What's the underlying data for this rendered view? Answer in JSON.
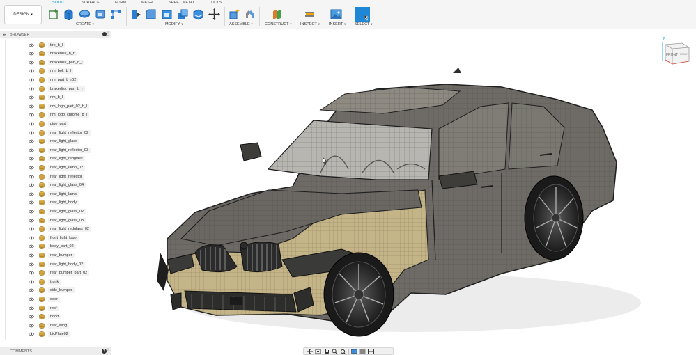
{
  "workspace": {
    "label": "DESIGN"
  },
  "tabs": [
    {
      "label": "SOLID",
      "active": true
    },
    {
      "label": "SURFACE",
      "active": false
    },
    {
      "label": "FORM",
      "active": false
    },
    {
      "label": "MESH",
      "active": false
    },
    {
      "label": "SHEET METAL",
      "active": false
    },
    {
      "label": "TOOLS",
      "active": false
    }
  ],
  "groups": {
    "create": "CREATE",
    "modify": "MODIFY",
    "assemble": "ASSEMBLE",
    "construct": "CONSTRUCT",
    "inspect": "INSPECT",
    "insert": "INSERT",
    "select": "SELECT"
  },
  "browser": {
    "title": "BROWSER",
    "items": [
      "tire_b_l",
      "brakedisk_b_r",
      "brakedisk_part_b_l",
      "rim_bolt_b_l",
      "rim_part_b_r02",
      "brakedisk_part_b_r",
      "rim_b_l",
      "rim_logo_part_02_b_l",
      "rim_logo_chrome_b_l",
      "pipe_part",
      "rear_light_reflector_02",
      "rear_light_glass",
      "rear_light_reflector_03",
      "rear_light_redglass",
      "rear_light_lamp_02",
      "rear_light_reflector",
      "rear_light_glass_04",
      "rear_light_lamp",
      "rear_light_body",
      "rear_light_glass_02",
      "rear_light_glass_03",
      "rear_light_redglass_02",
      "front_light_logo",
      "body_part_02",
      "rear_bumper",
      "rear_light_body_02",
      "rear_bumper_part_02",
      "trunk",
      "side_bumper",
      "door",
      "roof",
      "hood",
      "rear_wing",
      "LicPlate02"
    ]
  },
  "comments": {
    "title": "COMMENTS"
  },
  "viewcube": {
    "front": "FRONT",
    "right": "RIGHT",
    "axis_z": "Z"
  },
  "colors": {
    "accent": "#0696d7",
    "body_color": "#6e6b66",
    "highlight_color": "#c9b98a"
  }
}
